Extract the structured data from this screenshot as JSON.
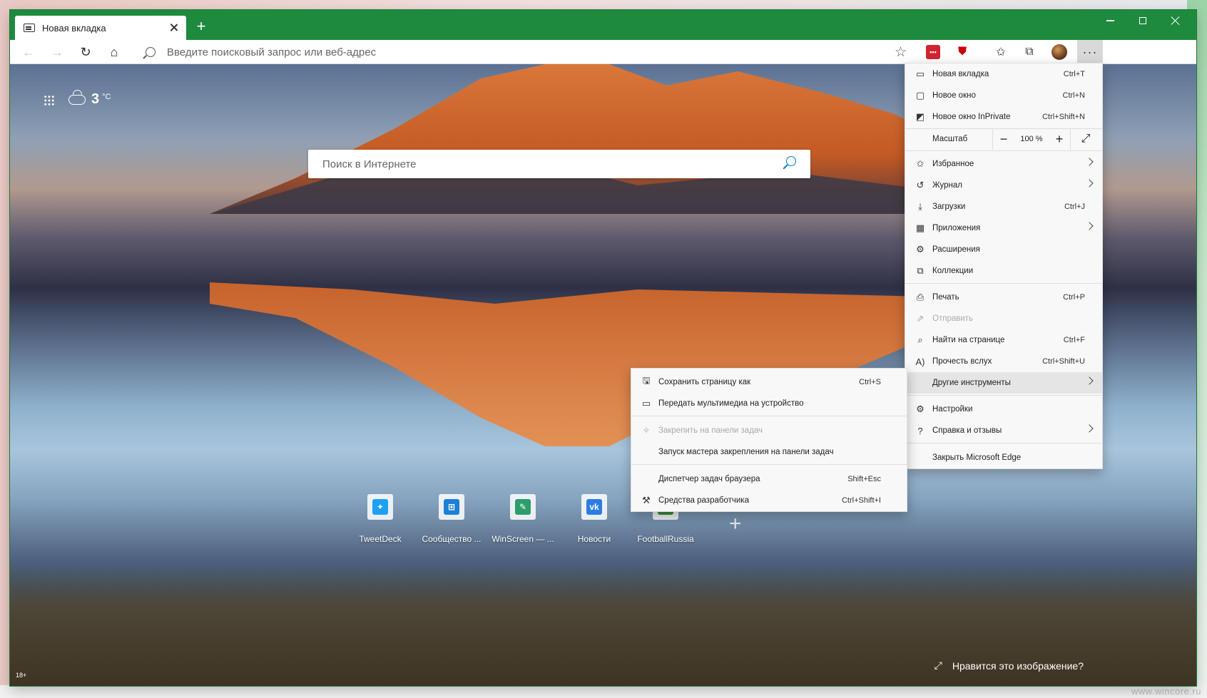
{
  "tab": {
    "title": "Новая вкладка",
    "icon": "new-tab-icon"
  },
  "window_controls": {
    "minimize": "minimize-icon",
    "maximize": "maximize-icon",
    "close": "close-icon"
  },
  "toolbar": {
    "address_placeholder": "Введите поисковый запрос или веб-адрес",
    "ext_red_label": "•••"
  },
  "newtab": {
    "temperature": "3",
    "temp_unit": "°C",
    "search_placeholder": "Поиск в Интернете",
    "tiles": [
      {
        "label": "TweetDeck",
        "color": "#1da1f2",
        "glyph": "🐦"
      },
      {
        "label": "Сообщество ...",
        "color": "#1e7fd6",
        "glyph": "▦"
      },
      {
        "label": "WinScreen — ...",
        "color": "#2d9d6b",
        "glyph": "✎"
      },
      {
        "label": "Новости",
        "color": "#2b7de0",
        "glyph": "vk"
      },
      {
        "label": "FootballRussia",
        "color": "#3a8a3a",
        "glyph": ""
      }
    ],
    "like_image": "Нравится это изображение?",
    "age_badge": "18+"
  },
  "menu": {
    "items": [
      {
        "label": "Новая вкладка",
        "shortcut": "Ctrl+T",
        "icon": "new-tab-icon"
      },
      {
        "label": "Новое окно",
        "shortcut": "Ctrl+N",
        "icon": "new-window-icon"
      },
      {
        "label": "Новое окно InPrivate",
        "shortcut": "Ctrl+Shift+N",
        "icon": "inprivate-icon"
      }
    ],
    "zoom_label": "Масштаб",
    "zoom_value": "100 %",
    "items2": [
      {
        "label": "Избранное",
        "shortcut": "",
        "icon": "favorites-icon",
        "arrow": true
      },
      {
        "label": "Журнал",
        "shortcut": "",
        "icon": "history-icon",
        "arrow": true
      },
      {
        "label": "Загрузки",
        "shortcut": "Ctrl+J",
        "icon": "download-icon"
      },
      {
        "label": "Приложения",
        "shortcut": "",
        "icon": "apps-icon",
        "arrow": true
      },
      {
        "label": "Расширения",
        "shortcut": "",
        "icon": "extensions-icon"
      },
      {
        "label": "Коллекции",
        "shortcut": "",
        "icon": "collections-icon"
      }
    ],
    "items3": [
      {
        "label": "Печать",
        "shortcut": "Ctrl+P",
        "icon": "print-icon"
      },
      {
        "label": "Отправить",
        "shortcut": "",
        "icon": "share-icon",
        "disabled": true
      },
      {
        "label": "Найти на странице",
        "shortcut": "Ctrl+F",
        "icon": "find-icon"
      },
      {
        "label": "Прочесть вслух",
        "shortcut": "Ctrl+Shift+U",
        "icon": "read-aloud-icon"
      },
      {
        "label": "Другие инструменты",
        "shortcut": "",
        "icon": "",
        "arrow": true,
        "active": true
      }
    ],
    "items4": [
      {
        "label": "Настройки",
        "shortcut": "",
        "icon": "settings-icon"
      },
      {
        "label": "Справка и отзывы",
        "shortcut": "",
        "icon": "help-icon",
        "arrow": true
      }
    ],
    "close_label": "Закрыть Microsoft Edge"
  },
  "submenu": {
    "items": [
      {
        "label": "Сохранить страницу как",
        "shortcut": "Ctrl+S",
        "icon": "save-page-icon"
      },
      {
        "label": "Передать мультимедиа на устройство",
        "shortcut": "",
        "icon": "cast-icon"
      },
      {
        "label": "Закрепить на панели задач",
        "shortcut": "",
        "icon": "pin-icon",
        "disabled": true
      },
      {
        "label": "Запуск мастера закрепления на панели задач",
        "shortcut": "",
        "icon": ""
      },
      {
        "label": "Диспетчер задач браузера",
        "shortcut": "Shift+Esc",
        "icon": ""
      },
      {
        "label": "Средства разработчика",
        "shortcut": "Ctrl+Shift+I",
        "icon": "devtools-icon"
      }
    ]
  },
  "watermark": "www.wincore.ru"
}
